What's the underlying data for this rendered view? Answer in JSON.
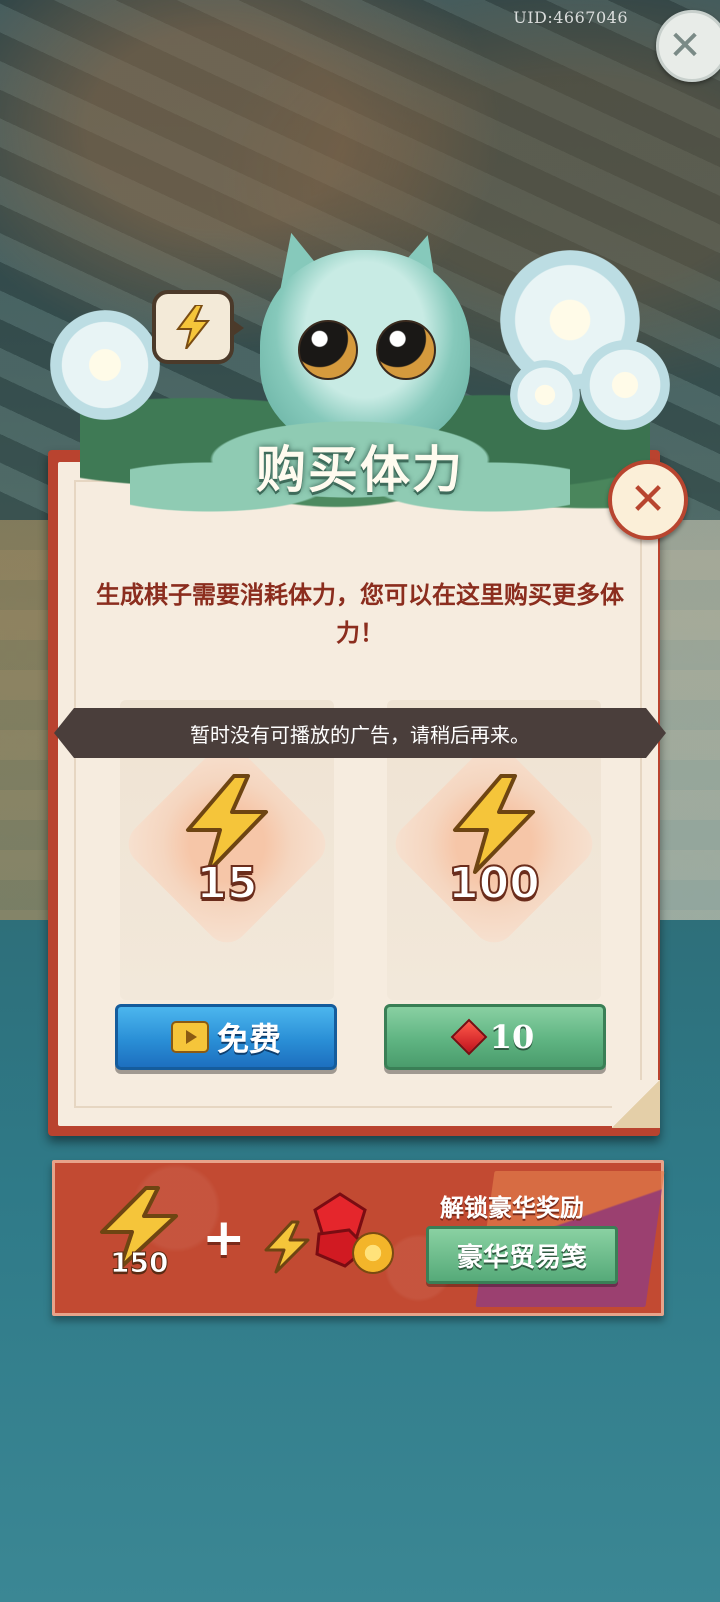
{
  "uid": "UID:4667046",
  "title": "购买体力",
  "description": "生成棋子需要消耗体力，您可以在这里购买更多体力！",
  "ad_banner": "暂时没有可播放的广告，请稍后再来。",
  "offers": [
    {
      "amount": "15",
      "button_label": "免费",
      "button_icon": "video-play-icon"
    },
    {
      "amount": "100",
      "button_label": "10",
      "button_icon": "red-gem-icon"
    }
  ],
  "promo": {
    "energy_amount": "150",
    "title": "解锁豪华奖励",
    "button_label": "豪华贸易笺"
  },
  "colors": {
    "panel_border": "#b9432f",
    "panel_bg": "#f6ecdf",
    "title_green": "#8fcbb3",
    "text_red": "#8b2d1e",
    "free_button": "#2a8fd6",
    "gem_button": "#5fb482"
  }
}
